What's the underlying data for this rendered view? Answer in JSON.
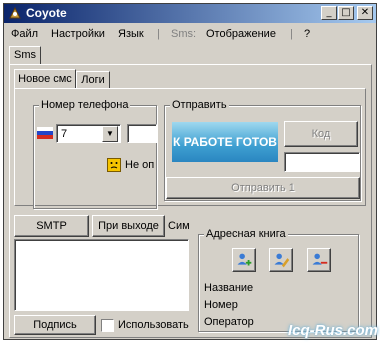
{
  "app": {
    "title": "Coyote"
  },
  "menu": {
    "items": [
      "Файл",
      "Настройки",
      "Язык",
      "Sms:",
      "Отображение",
      "?"
    ],
    "separators": [
      "|",
      "|"
    ]
  },
  "tabs": {
    "outer": "Sms",
    "inner": [
      "Новое смс",
      "Логи"
    ]
  },
  "phone_group": {
    "label": "Номер телефона",
    "country_code": "7",
    "number": "",
    "status": "Не оп"
  },
  "send_group": {
    "label": "Отправить",
    "banner_text": "К РАБОТЕ ГОТОВ",
    "code_button": "Код",
    "code_value": "",
    "send_button": "Отправить 1"
  },
  "buttons": {
    "smtp": "SMTP",
    "on_exit": "При выходе",
    "sim": "Сим",
    "signature": "Подпись"
  },
  "message_text": "",
  "use_checkbox": {
    "label": "Использовать",
    "checked": false
  },
  "address_book": {
    "label": "Адресная книга",
    "fields": [
      "Название",
      "Номер",
      "Оператор"
    ]
  },
  "watermark": "Icq-Rus.com",
  "colors": {
    "titlebar_start": "#0a246a",
    "titlebar_end": "#a6caf0",
    "face": "#d4d0c8",
    "banner": "#3e9fd1",
    "warning": "#f5c400"
  }
}
